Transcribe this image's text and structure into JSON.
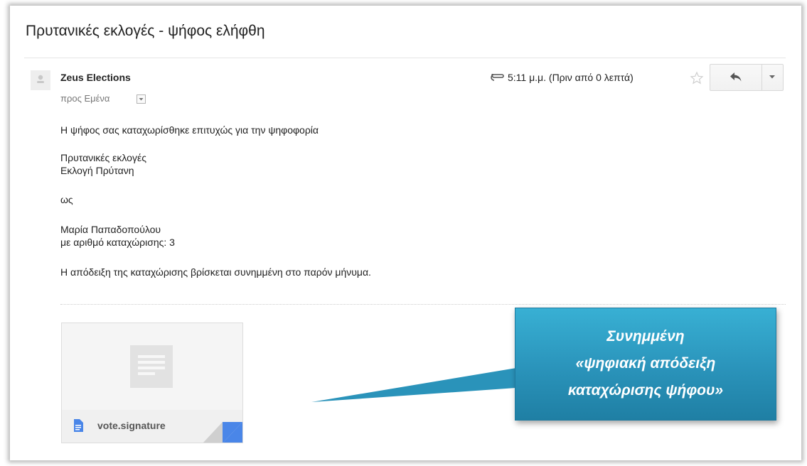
{
  "email": {
    "subject": "Πρυτανικές εκλογές - ψήφος ελήφθη",
    "sender_name": "Zeus Elections",
    "to_line": "προς Εμένα",
    "timestamp": "5:11 μ.μ. (Πριν από 0 λεπτά)",
    "body_lines": [
      "Η ψήφος σας καταχωρίσθηκε επιτυχώς για την ψηφοφορία",
      "Πρυτανικές εκλογές",
      "Εκλογή Πρύτανη",
      "ως",
      "Μαρία Παπαδοπούλου",
      "με αριθμό καταχώρισης: 3",
      "Η απόδειξη της καταχώρισης βρίσκεται συνημμένη στο παρόν μήνυμα."
    ]
  },
  "attachment": {
    "file_name": "vote.signature",
    "icon": "document-icon",
    "corner_color": "#4a86e8"
  },
  "callout": {
    "lines": [
      "Συνημμένη",
      "«ψηφιακή απόδειξη",
      "καταχώρισης ψήφου»"
    ],
    "color": "#2a93ba"
  },
  "icons": {
    "avatar": "person-icon",
    "attachment_indicator": "paperclip-icon",
    "star": "star-icon",
    "reply": "reply-icon",
    "more": "dropdown-arrow-icon"
  }
}
